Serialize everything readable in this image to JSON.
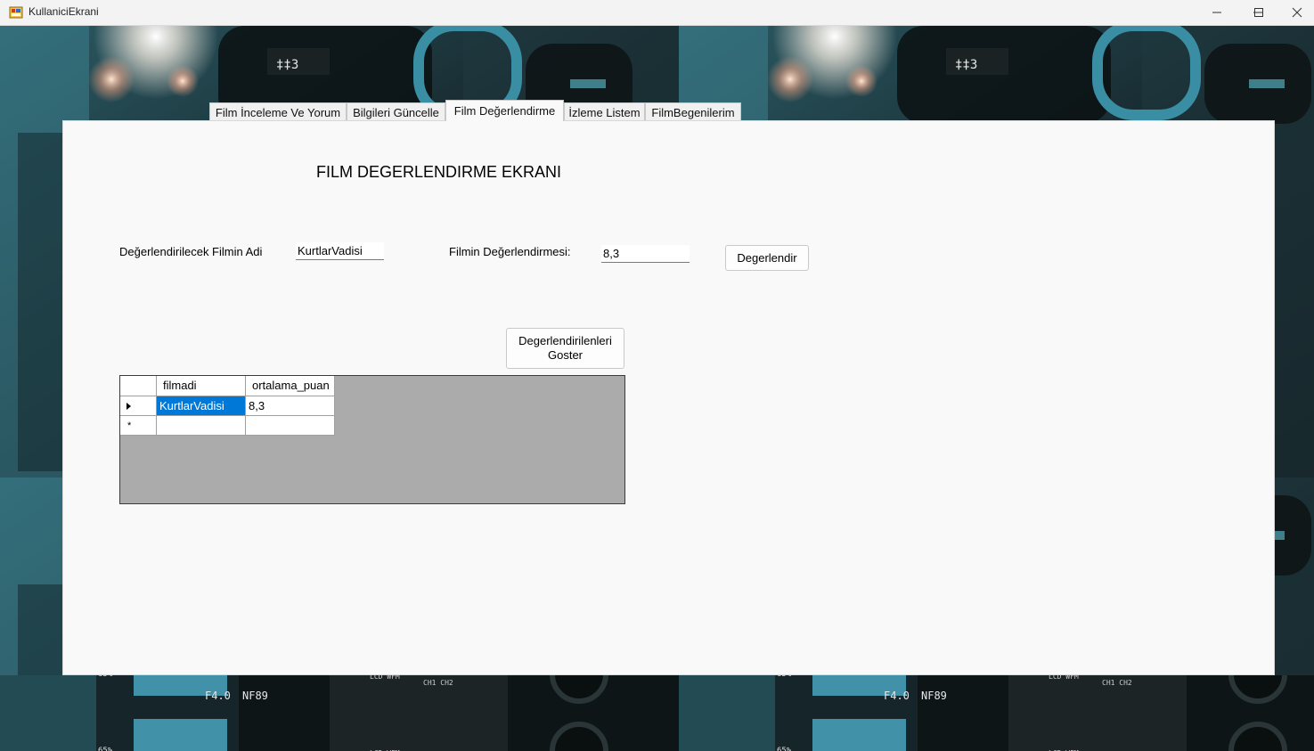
{
  "window": {
    "title": "KullaniciEkrani",
    "controls": [
      "minimize-icon",
      "maximize-icon",
      "close-icon"
    ]
  },
  "tabs": [
    {
      "label": "Film İnceleme Ve Yorum",
      "active": false
    },
    {
      "label": "Bilgileri Güncelle",
      "active": false
    },
    {
      "label": "Film Değerlendirme",
      "active": true
    },
    {
      "label": "İzleme Listem",
      "active": false
    },
    {
      "label": "FilmBegenilerim",
      "active": false
    }
  ],
  "page": {
    "heading": "FILM DEGERLENDIRME EKRANI",
    "film_name_label": "Değerlendirilecek Filmin Adi",
    "film_name_value": "KurtlarVadisi",
    "rating_label": "Filmin Değerlendirmesi:",
    "rating_value": "8,3",
    "rate_button": "Degerlendir",
    "show_button": "Degerlendirilenleri Goster"
  },
  "grid": {
    "columns": [
      "filmadi",
      "ortalama_puan"
    ],
    "rows": [
      {
        "filmadi": "KurtlarVadisi",
        "ortalama_puan": "8,3",
        "current": true
      }
    ],
    "new_row_marker": "*"
  },
  "colors": {
    "selection": "#0078d7",
    "grid_background": "#ababab",
    "panel": "#f9f9f9"
  }
}
